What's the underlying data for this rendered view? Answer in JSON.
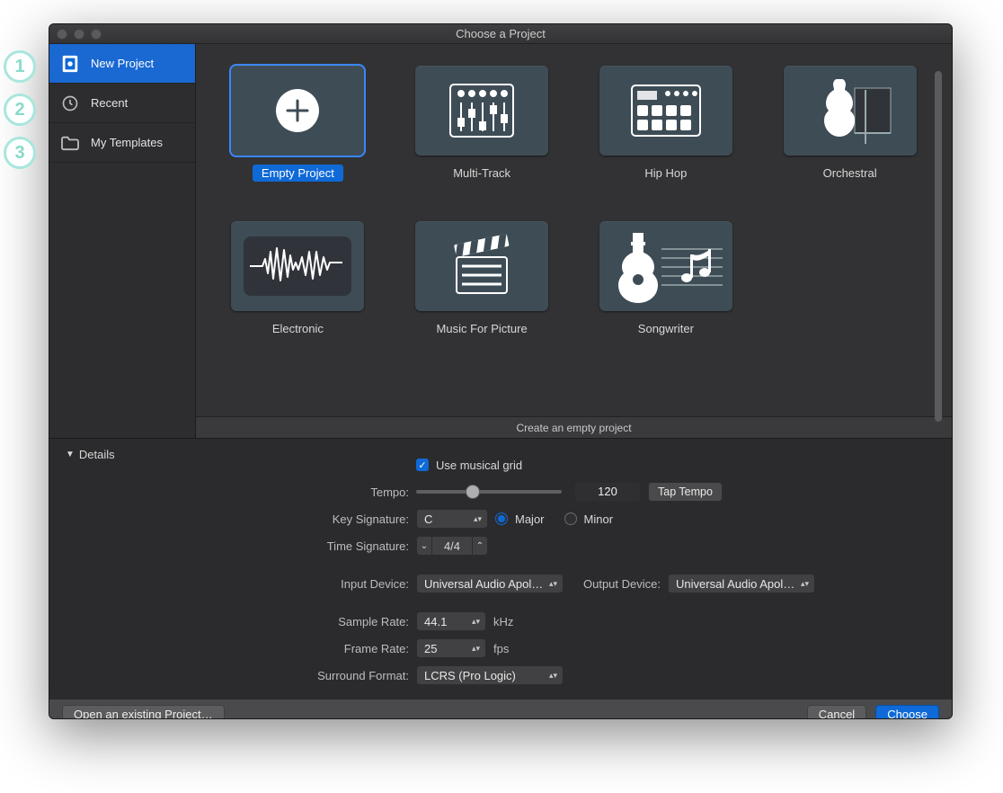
{
  "annotations": [
    "1",
    "2",
    "3"
  ],
  "titlebar": {
    "title": "Choose a Project"
  },
  "sidebar": {
    "items": [
      {
        "label": "New Project",
        "selected": true,
        "icon": "file-plus"
      },
      {
        "label": "Recent",
        "selected": false,
        "icon": "clock"
      },
      {
        "label": "My Templates",
        "selected": false,
        "icon": "folder"
      }
    ]
  },
  "templates": {
    "description": "Create an empty project",
    "items": [
      {
        "name": "Empty Project",
        "icon": "plus-circle",
        "selected": true
      },
      {
        "name": "Multi-Track",
        "icon": "mixer"
      },
      {
        "name": "Hip Hop",
        "icon": "drum-machine"
      },
      {
        "name": "Orchestral",
        "icon": "violin"
      },
      {
        "name": "Electronic",
        "icon": "waveform"
      },
      {
        "name": "Music For Picture",
        "icon": "clapper"
      },
      {
        "name": "Songwriter",
        "icon": "guitar"
      }
    ]
  },
  "details": {
    "toggle_label": "Details",
    "use_musical_grid": {
      "label": "Use musical grid",
      "checked": true
    },
    "tempo": {
      "label": "Tempo:",
      "value": "120",
      "tap_btn": "Tap Tempo"
    },
    "key_signature": {
      "label": "Key Signature:",
      "value": "C",
      "mode_major": "Major",
      "mode_minor": "Minor",
      "mode": "major"
    },
    "time_signature": {
      "label": "Time Signature:",
      "value": "4/4"
    },
    "input_device": {
      "label": "Input Device:",
      "value": "Universal Audio Apoll…"
    },
    "output_device": {
      "label": "Output Device:",
      "value": "Universal Audio Apoll…"
    },
    "sample_rate": {
      "label": "Sample Rate:",
      "value": "44.1",
      "unit": "kHz"
    },
    "frame_rate": {
      "label": "Frame Rate:",
      "value": "25",
      "unit": "fps"
    },
    "surround": {
      "label": "Surround Format:",
      "value": "LCRS (Pro Logic)"
    }
  },
  "footer": {
    "open_existing": "Open an existing Project…",
    "cancel": "Cancel",
    "choose": "Choose"
  }
}
